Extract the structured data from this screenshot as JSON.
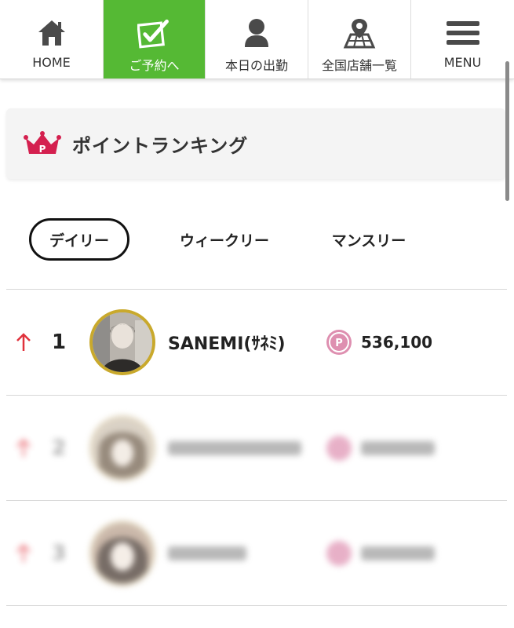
{
  "nav": {
    "items": [
      {
        "label": "HOME",
        "icon": "home-icon"
      },
      {
        "label": "ご予約へ",
        "icon": "checkbox-icon"
      },
      {
        "label": "本日の出勤",
        "icon": "person-icon"
      },
      {
        "label": "全国店舗一覧",
        "icon": "map-pin-icon"
      },
      {
        "label": "MENU",
        "icon": "hamburger-icon"
      }
    ],
    "active_color": "#55b934"
  },
  "section": {
    "title": "ポイントランキング",
    "icon": "crown-icon",
    "icon_color": "#d4204f"
  },
  "tabs": [
    {
      "label": "デイリー",
      "selected": true
    },
    {
      "label": "ウィークリー",
      "selected": false
    },
    {
      "label": "マンスリー",
      "selected": false
    }
  ],
  "ranking": [
    {
      "rank": "1",
      "trend": "up",
      "name": "SANEMI(ｻﾈﾐ)",
      "points": "536,100",
      "point_icon": "P"
    },
    {
      "rank": "2",
      "trend": "up",
      "name": "",
      "points": "",
      "point_icon": "P"
    },
    {
      "rank": "3",
      "trend": "up",
      "name": "",
      "points": "",
      "point_icon": "P"
    }
  ],
  "colors": {
    "trend_up": "#e0323c",
    "point_badge": "#de8fb0",
    "avatar_ring": "#c9a92c"
  }
}
